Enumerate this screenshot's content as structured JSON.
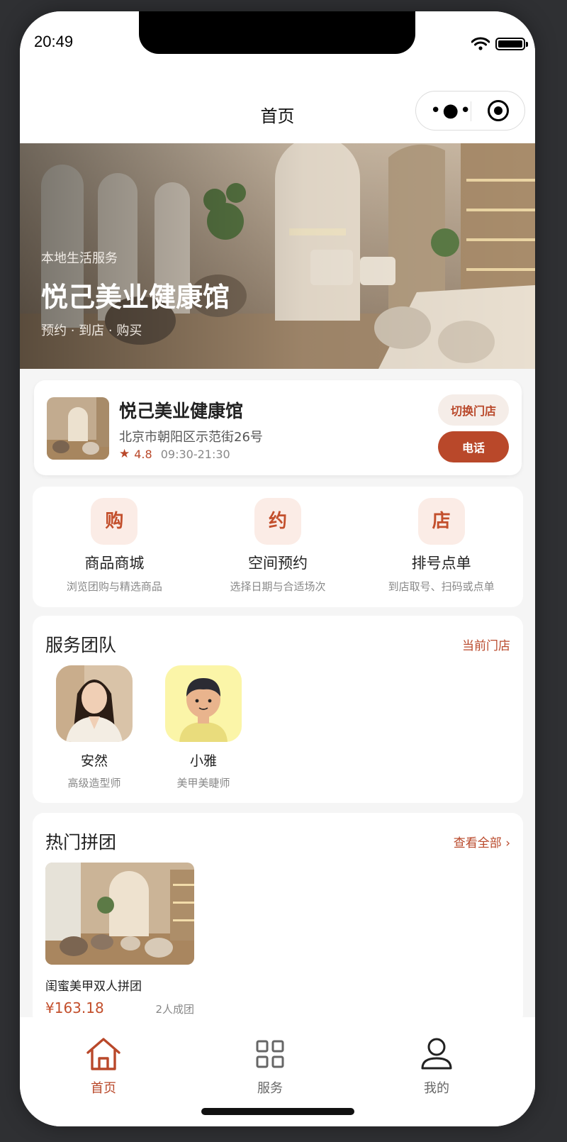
{
  "status_bar": {
    "time": "20:49"
  },
  "nav": {
    "title": "首页",
    "capsule_more_icon": "more-dots-icon",
    "capsule_close_icon": "target-icon"
  },
  "banner": {
    "subtitle": "本地生活服务",
    "title": "悦己美业健康馆",
    "tags": "预约 · 到店 · 购买"
  },
  "store": {
    "name": "悦己美业健康馆",
    "address": "北京市朝阳区示范街26号",
    "rating": "4.8",
    "hours": "09:30-21:30",
    "switch_label": "切换门店",
    "call_label": "电话"
  },
  "quick_entries": [
    {
      "icon": "购",
      "label": "商品商城",
      "desc": "浏览团购与精选商品"
    },
    {
      "icon": "约",
      "label": "空间预约",
      "desc": "选择日期与合适场次"
    },
    {
      "icon": "店",
      "label": "排号点单",
      "desc": "到店取号、扫码或点单"
    }
  ],
  "team": {
    "title": "服务团队",
    "link": "当前门店",
    "members": [
      {
        "name": "安然",
        "role": "高级造型师"
      },
      {
        "name": "小雅",
        "role": "美甲美睫师"
      }
    ]
  },
  "group_buy": {
    "title": "热门拼团",
    "link": "查看全部 ›",
    "deals": [
      {
        "name": "闺蜜美甲双人拼团",
        "price": "¥163.18",
        "size": "2人成团"
      }
    ]
  },
  "tabbar": {
    "items": [
      {
        "label": "首页",
        "icon": "home-icon",
        "active": true
      },
      {
        "label": "服务",
        "icon": "grid-icon",
        "active": false
      },
      {
        "label": "我的",
        "icon": "user-icon",
        "active": false
      }
    ]
  },
  "colors": {
    "accent": "#b9482a",
    "accent_light": "#fbece6",
    "background": "#f5f5f5"
  }
}
